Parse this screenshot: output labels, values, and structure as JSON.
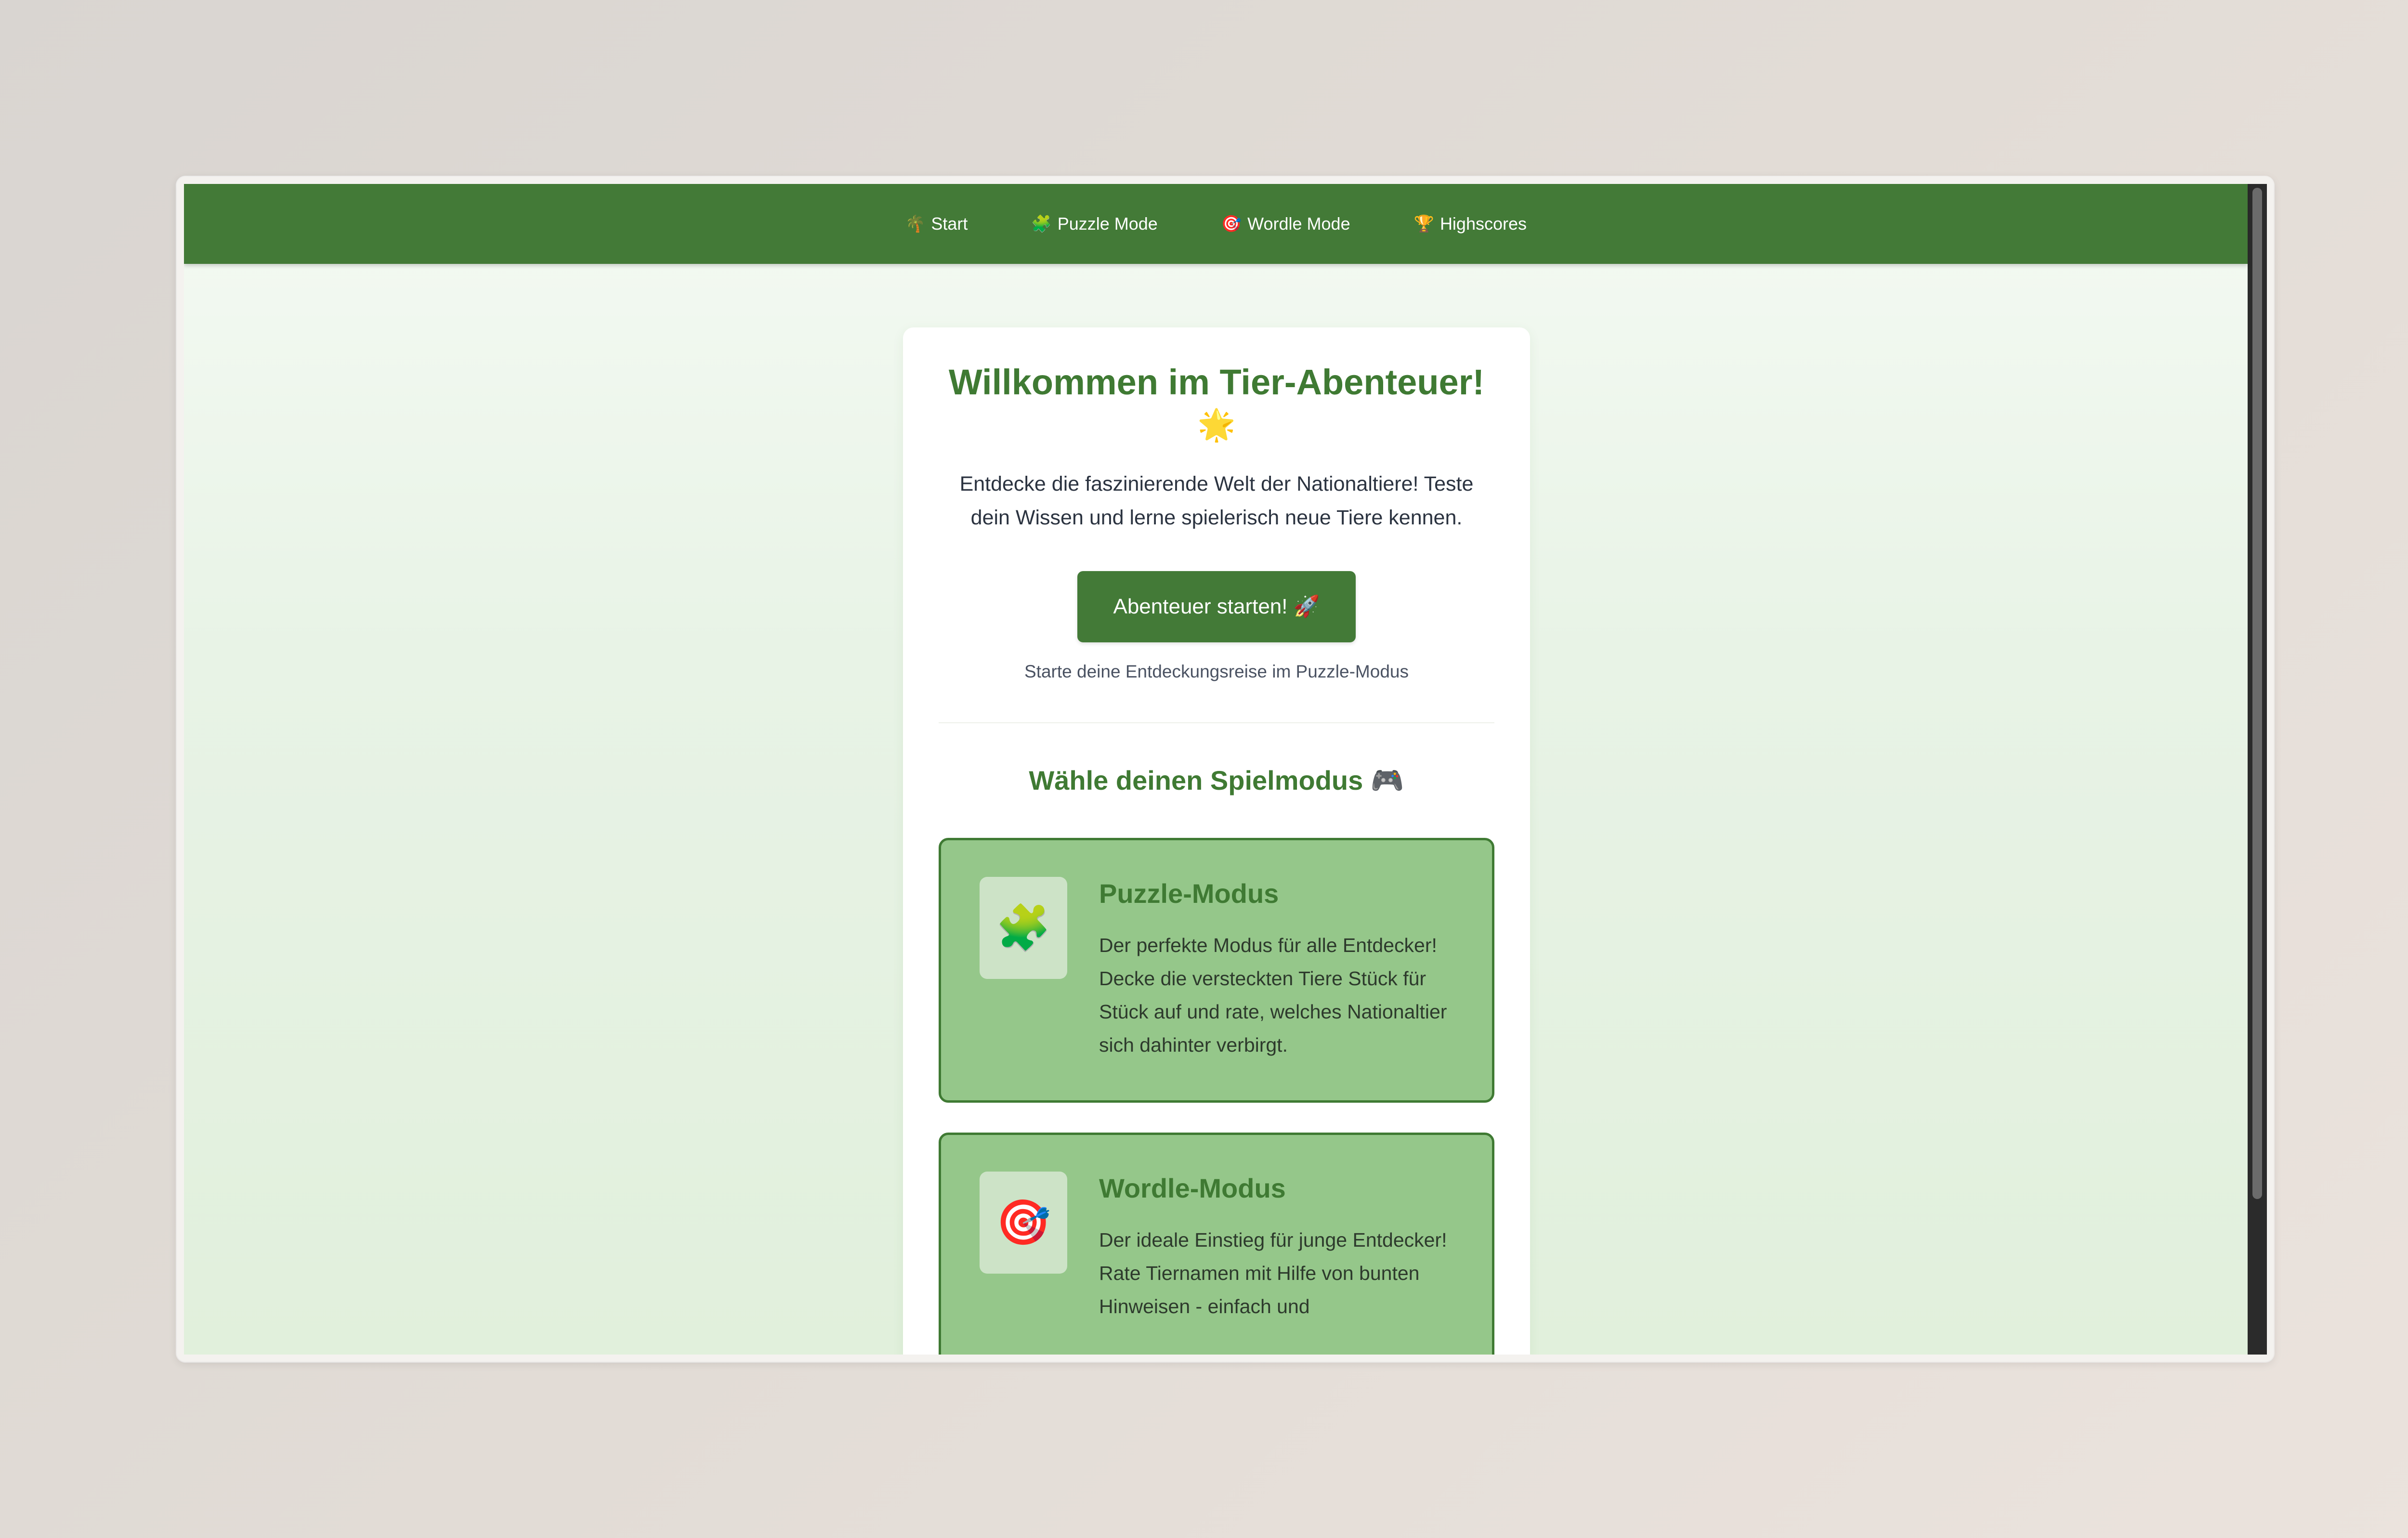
{
  "nav": {
    "items": [
      {
        "id": "start",
        "icon": "🌴",
        "label": "Start"
      },
      {
        "id": "puzzle",
        "icon": "🧩",
        "label": "Puzzle Mode"
      },
      {
        "id": "wordle",
        "icon": "🎯",
        "label": "Wordle Mode"
      },
      {
        "id": "highscores",
        "icon": "🏆",
        "label": "Highscores"
      }
    ]
  },
  "welcome": {
    "title": "Willkommen im Tier-Abenteuer!",
    "title_icon": "🌟",
    "intro": "Entdecke die faszinierende Welt der Nationaltiere! Teste dein Wissen und lerne spielerisch neue Tiere kennen.",
    "cta_label": "Abenteuer starten! 🚀",
    "cta_hint": "Starte deine Entdeckungsreise im Puzzle-Modus"
  },
  "modes": {
    "title": "Wähle deinen Spielmodus 🎮",
    "items": [
      {
        "icon": "🧩",
        "title": "Puzzle-Modus",
        "description": "Der perfekte Modus für alle Entdecker! Decke die versteckten Tiere Stück für Stück auf und rate, welches Nationaltier sich dahinter verbirgt."
      },
      {
        "icon": "🎯",
        "title": "Wordle-Modus",
        "description": "Der ideale Einstieg für junge Entdecker! Rate Tiernamen mit Hilfe von bunten Hinweisen - einfach und"
      }
    ]
  },
  "colors": {
    "nav_bg": "#437a37",
    "accent_green": "#3f7a33",
    "mode_card_bg": "#95c78a"
  }
}
